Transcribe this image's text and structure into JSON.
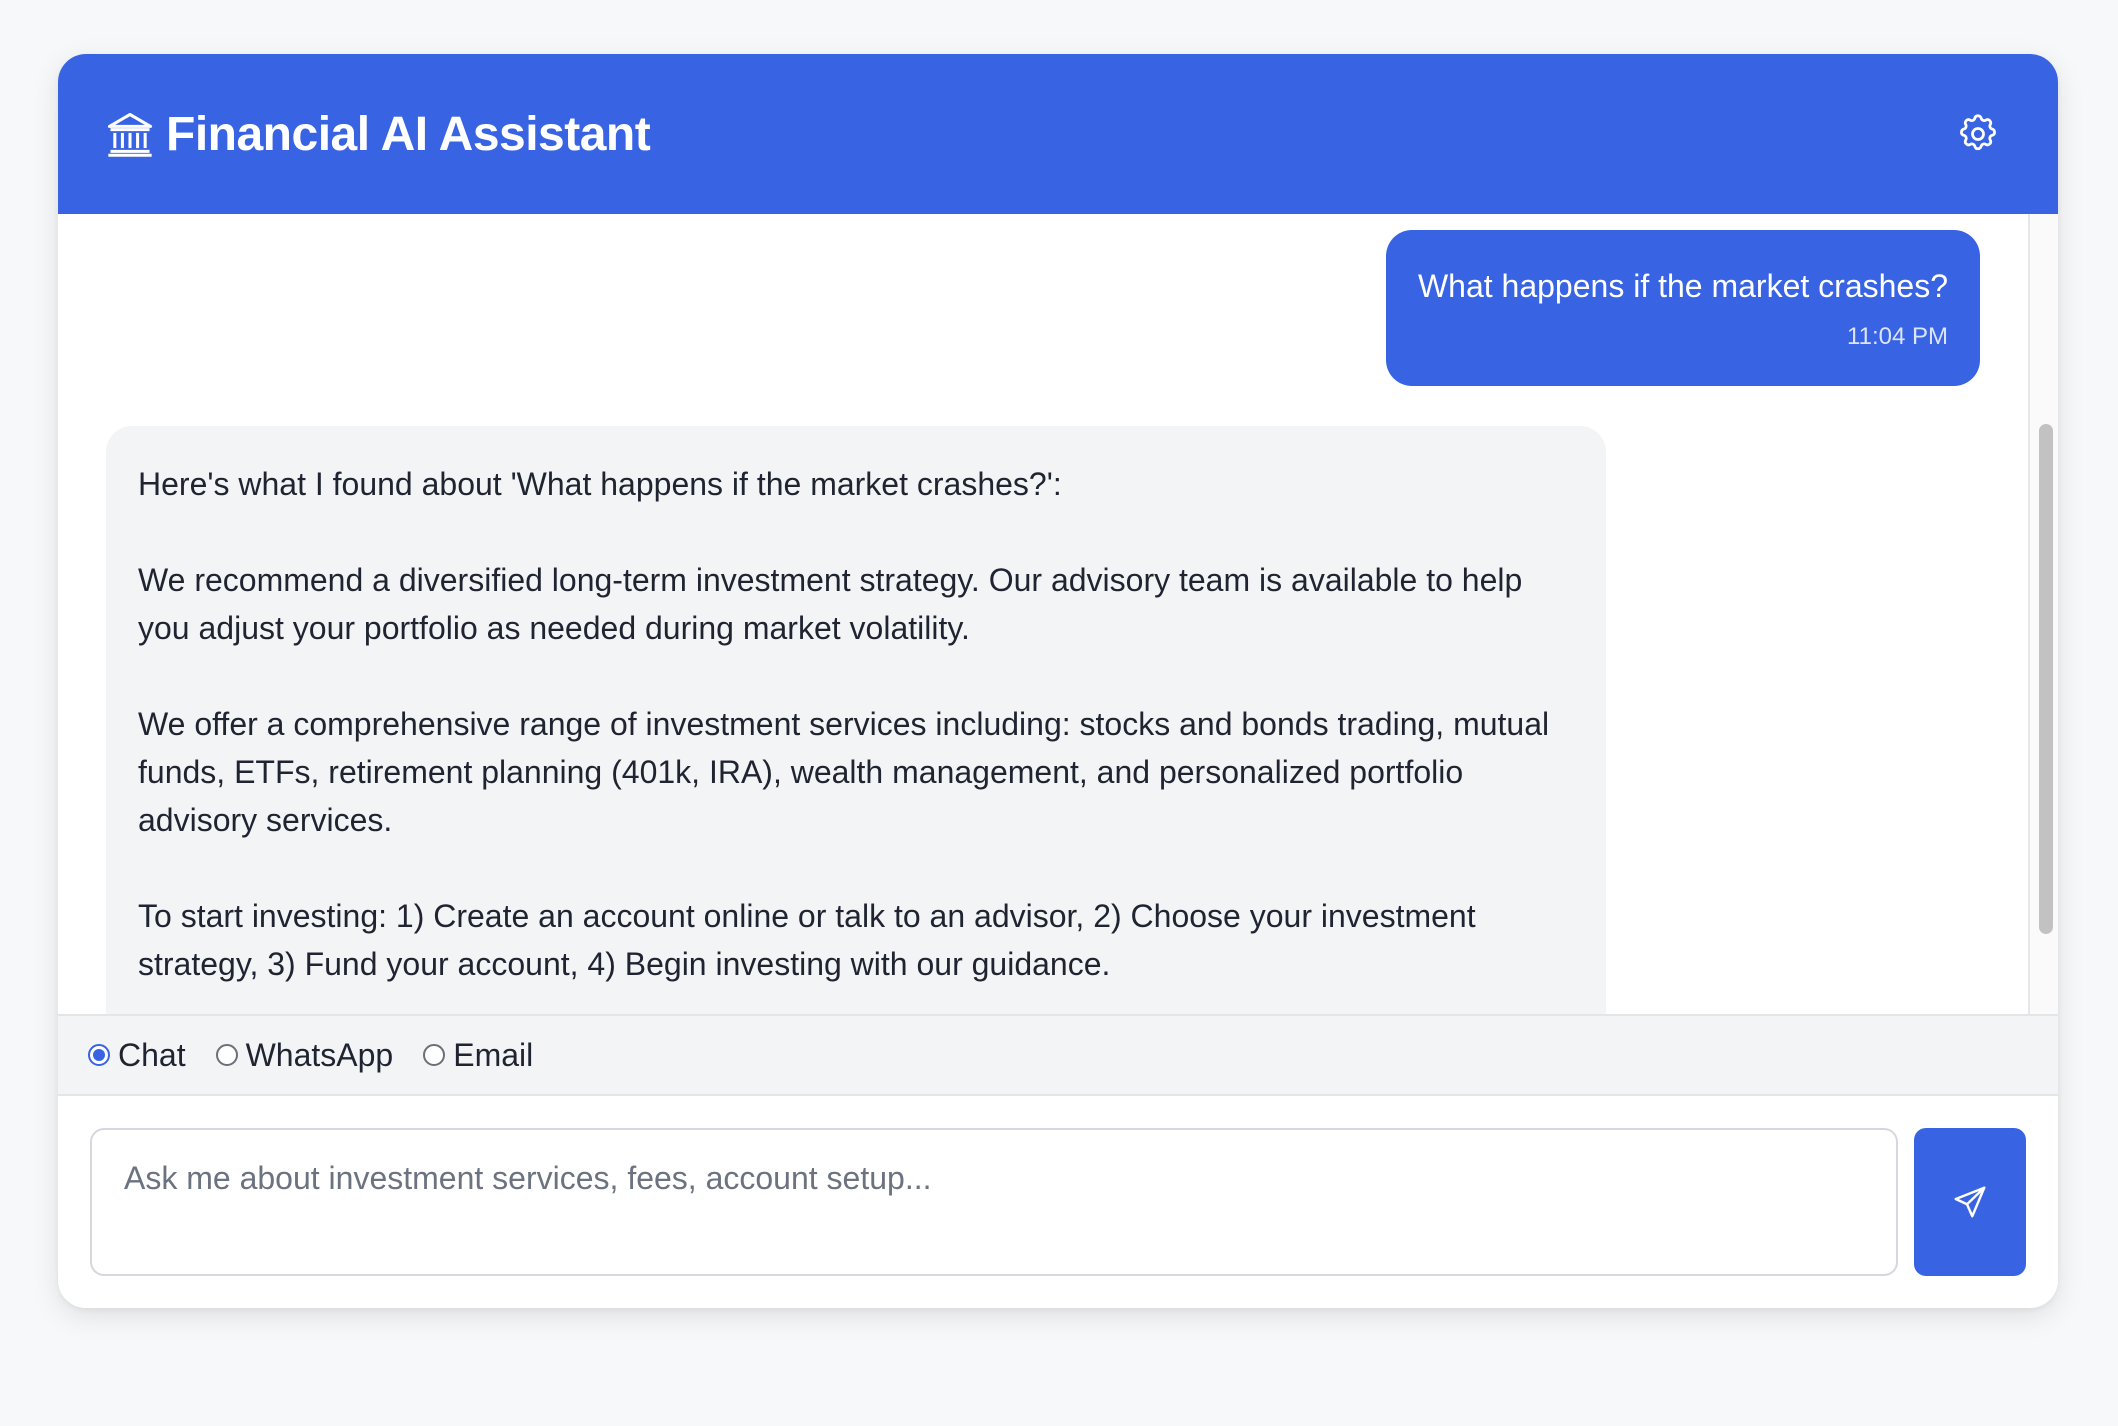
{
  "header": {
    "title": "Financial AI Assistant",
    "logo_icon": "bank-icon",
    "settings_icon": "gear-icon",
    "background_color": "#3864e4"
  },
  "messages": {
    "user": {
      "text": "What happens if the market crashes?",
      "time": "11:04 PM"
    },
    "bot": {
      "paragraphs": [
        "Here's what I found about 'What happens if the market crashes?':",
        "We recommend a diversified long-term investment strategy. Our advisory team is available to help you adjust your portfolio as needed during market volatility.",
        "We offer a comprehensive range of investment services including: stocks and bonds trading, mutual funds, ETFs, retirement planning (401k, IRA), wealth management, and personalized portfolio advisory services.",
        "To start investing: 1) Create an account online or talk to an advisor, 2) Choose your investment strategy, 3) Fund your account, 4) Begin investing with our guidance."
      ]
    }
  },
  "channels": {
    "selected": "Chat",
    "options": [
      {
        "label": "Chat",
        "checked": true
      },
      {
        "label": "WhatsApp",
        "checked": false
      },
      {
        "label": "Email",
        "checked": false
      }
    ]
  },
  "composer": {
    "placeholder": "Ask me about investment services, fees, account setup...",
    "value": "",
    "send_icon": "paper-plane-icon"
  }
}
